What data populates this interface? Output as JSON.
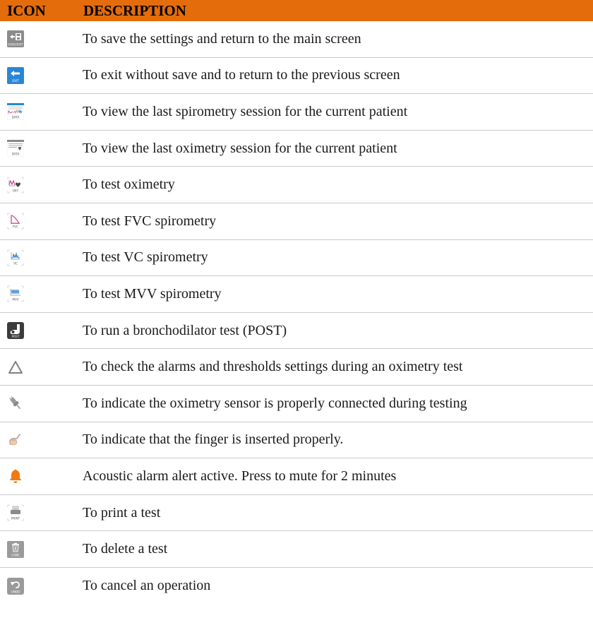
{
  "header": {
    "icon_col": "ICON",
    "desc_col": "DESCRIPTION"
  },
  "rows": [
    {
      "icon": "save-exit-icon",
      "icon_text": "SAVE/EXIT",
      "description": "To save the settings and return to the main screen"
    },
    {
      "icon": "exit-icon",
      "icon_text": "EXIT",
      "description": "To exit without save and to return to the previous screen"
    },
    {
      "icon": "spirometry-data-icon",
      "icon_text": "DATA",
      "description": "To view the last spirometry session for the current patient"
    },
    {
      "icon": "oximetry-data-icon",
      "icon_text": "DATA",
      "description": "To view the last oximetry session for the current patient"
    },
    {
      "icon": "oxy-test-icon",
      "icon_text": "OXY",
      "description": "To test oximetry"
    },
    {
      "icon": "fvc-test-icon",
      "icon_text": "FVC",
      "description": "To test FVC spirometry"
    },
    {
      "icon": "vc-test-icon",
      "icon_text": "VC",
      "description": "To test VC spirometry"
    },
    {
      "icon": "mvv-test-icon",
      "icon_text": "MVV",
      "description": "To test MVV spirometry"
    },
    {
      "icon": "post-test-icon",
      "icon_text": "POST",
      "description": "To run a bronchodilator test (POST)"
    },
    {
      "icon": "alarm-triangle-icon",
      "icon_text": "",
      "description": "To check the alarms and thresholds settings during an oximetry test"
    },
    {
      "icon": "sensor-connected-icon",
      "icon_text": "",
      "description": "To indicate the oximetry sensor is properly connected during testing"
    },
    {
      "icon": "finger-inserted-icon",
      "icon_text": "",
      "description": "To indicate that the finger is inserted properly."
    },
    {
      "icon": "bell-alarm-icon",
      "icon_text": "",
      "description": "Acoustic alarm alert active. Press to mute for 2 minutes"
    },
    {
      "icon": "print-icon",
      "icon_text": "PRINT",
      "description": "To print a test"
    },
    {
      "icon": "delete-icon",
      "icon_text": "CANC",
      "description": "To delete a test"
    },
    {
      "icon": "undo-icon",
      "icon_text": "UNDO",
      "description": "To cancel an operation"
    }
  ],
  "colors": {
    "header_bg": "#E46C0A",
    "accent_blue": "#2a86d4",
    "icon_gray": "#8a8a8a",
    "bell_orange": "#f07a12"
  }
}
